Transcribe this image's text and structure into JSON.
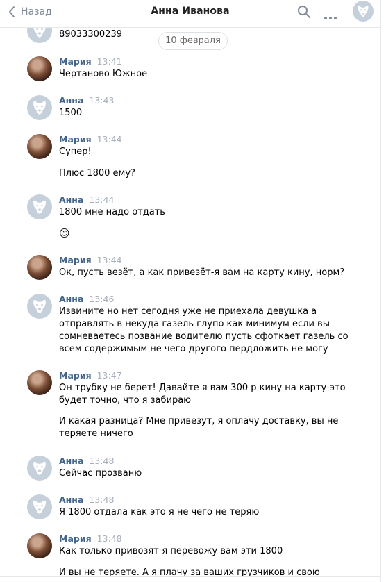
{
  "header": {
    "back_label": "Назад",
    "title": "Анна Иванова"
  },
  "date_divider": "10 февраля",
  "top_partial": {
    "text": "89033300239"
  },
  "messages": [
    {
      "author": "Мария",
      "time": "13:41",
      "lines": [
        "Чертаново Южное"
      ]
    },
    {
      "author": "Анна",
      "time": "13:43",
      "lines": [
        "1500"
      ]
    },
    {
      "author": "Мария",
      "time": "13:44",
      "lines": [
        "Супер!",
        "Плюс 1800 ему?"
      ]
    },
    {
      "author": "Анна",
      "time": "13:44",
      "lines": [
        "1800 мне надо отдать",
        "😊"
      ]
    },
    {
      "author": "Мария",
      "time": "13:44",
      "lines": [
        "Ок, пусть везёт, а как привезёт-я вам на карту кину, норм?"
      ]
    },
    {
      "author": "Анна",
      "time": "13:46",
      "lines": [
        "Извините но нет сегодня уже не приехала девушка а",
        "отправлять в некуда газель глупо как минимум если вы",
        "сомневаетесь позвание водителю пусть сфоткает газель со",
        "всем содержимым не чего другого пердложить не могу"
      ]
    },
    {
      "author": "Мария",
      "time": "13:47",
      "lines": [
        "Он трубку не берет! Давайте я вам 300 р кину на карту-это",
        "будет точно, что я забираю",
        "И какая разница? Мне привезут, я оплачу доставку, вы не",
        "теряете ничего"
      ]
    },
    {
      "author": "Анна",
      "time": "13:48",
      "lines": [
        "Сейчас прозваню"
      ]
    },
    {
      "author": "Анна",
      "time": "13:48",
      "lines": [
        "Я 1800 отдала как это я не чего не теряю"
      ]
    },
    {
      "author": "Мария",
      "time": "13:48",
      "lines": [
        "Как только привозят-я перевожу вам эти 1800",
        "И вы не теряете. А я плачу за ваших грузчиков и свою"
      ]
    }
  ]
}
